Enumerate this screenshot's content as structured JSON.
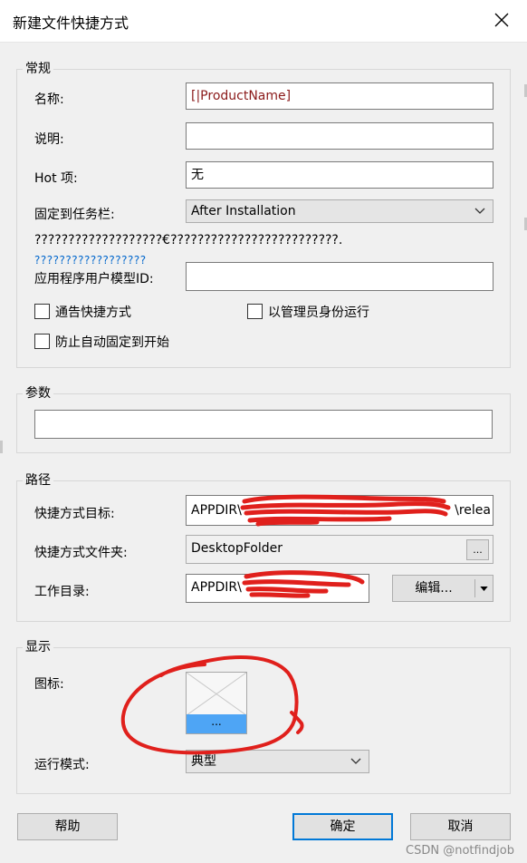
{
  "window": {
    "title": "新建文件快捷方式"
  },
  "general": {
    "legend": "常规",
    "name_label": "名称:",
    "name_value": "[|ProductName]",
    "desc_label": "说明:",
    "desc_value": "",
    "hotkey_label": "Hot 项:",
    "hotkey_value": "无",
    "pin_label": "固定到任务栏:",
    "pin_value": "After Installation",
    "warning_text": "???????????????????€?????????????????????????.",
    "link_text": "??????????????????",
    "appmodel_label": "应用程序用户模型ID:",
    "appmodel_value": "",
    "checkboxes": {
      "advertise": "通告快捷方式",
      "run_as_admin": "以管理员身份运行",
      "prevent_pin": "防止自动固定到开始"
    }
  },
  "args": {
    "legend": "参数",
    "value": ""
  },
  "path": {
    "legend": "路径",
    "target_label": "快捷方式目标:",
    "target_prefix": "APPDIR\\",
    "target_suffix": "\\relea",
    "folder_label": "快捷方式文件夹:",
    "folder_value": "DesktopFolder",
    "folder_browse": "...",
    "workdir_label": "工作目录:",
    "workdir_prefix": "APPDIR\\",
    "edit_button": "编辑..."
  },
  "display": {
    "legend": "显示",
    "icon_label": "图标:",
    "icon_button": "...",
    "runmode_label": "运行模式:",
    "runmode_value": "典型"
  },
  "buttons": {
    "help": "帮助",
    "ok": "确定",
    "cancel": "取消"
  },
  "watermark": "CSDN @notfindjob",
  "colors": {
    "accent": "#0078d7",
    "name_value": "#8b1a1a",
    "scribble": "#e0201c",
    "icon_bar": "#4ea5f5"
  }
}
